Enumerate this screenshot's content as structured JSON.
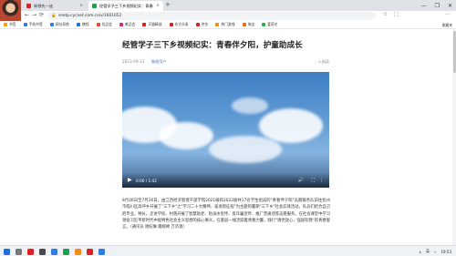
{
  "browser": {
    "tabs": [
      {
        "label": "联想先一迷",
        "favicon_color": "#e02020",
        "active": false
      },
      {
        "label": "经管学子三下乡视频纪实：青春",
        "favicon_color": "#17a34a",
        "active": true
      }
    ],
    "close_glyph": "×",
    "new_tab_glyph": "+",
    "window_controls": [
      "—",
      "❐",
      "✕"
    ],
    "address": "seetp.cycnet.com.cn/v/1601052",
    "lock_glyph": "🔒",
    "nav": {
      "back": "←",
      "forward": "→",
      "reload": "⟳",
      "home": "⌂"
    },
    "right_icons": [
      "☆",
      "⬚",
      "⋯"
    ],
    "bookmarks": [
      {
        "label": "书签",
        "color": "#f2a100"
      },
      {
        "label": "手机书签",
        "color": "#2f7de1"
      },
      {
        "label": "网址导航",
        "color": "#2f7de1"
      },
      {
        "label": "携程",
        "color": "#1f75d6"
      },
      {
        "label": "优品会",
        "color": "#e74c3c"
      },
      {
        "label": "唯品会",
        "color": "#d9257a"
      },
      {
        "label": "天猫精选",
        "color": "#e02020"
      },
      {
        "label": "东方头条",
        "color": "#e02020"
      },
      {
        "label": "京东",
        "color": "#e02020"
      },
      {
        "label": "热门游戏",
        "color": "#f28c18"
      },
      {
        "label": "淘宝",
        "color": "#f26b18"
      },
      {
        "label": "爱奇艺",
        "color": "#2bb24c"
      }
    ],
    "bookmarks_right": "收藏夹"
  },
  "article": {
    "title": "经管学子三下乡视频纪实：青春伴夕阳，护童助成长",
    "date": "2023-09-13",
    "source": "微视用户",
    "reads": "人阅读",
    "video": {
      "play_glyph": "▶",
      "time": "0:00 / 1:42",
      "volume_glyph": "🔊",
      "fullscreen_glyph": "⛶",
      "more_glyph": "⋮"
    },
    "body": "8月26日至7月26日，由江西经济管理干部学院2021级和2022级共17名学生组成的\"青春伴夕阳\"志愿服务队前往抚州市临川区高坪乡开展了\"三下乡\"之\"学习二十大精神，奋进新征程\"为主题的暑期\"三下乡\"社会实践活动。队员们结合自己的专业，特长，走进学校、村落开展了智慧助老、防溺水宣传、反诈骗宣传、推广普通话等志愿服务。在社会课堂中学习领会习近平新时代中国特色社会主义思想的核心要义。在基层一线活跃着青春力量，践行\"请党放心，强国有我\"的青春誓言。（通讯员 谢纪琳 雍婉婷 万济源）"
  },
  "taskbar": {
    "apps": [
      {
        "name": "start",
        "color": "#1e6fd9"
      },
      {
        "name": "search",
        "color": "#777777"
      },
      {
        "name": "app1",
        "color": "#e02020"
      },
      {
        "name": "app2",
        "color": "#4a4a4a"
      },
      {
        "name": "app3",
        "color": "#2f7de1"
      },
      {
        "name": "app4",
        "color": "#17a34a"
      },
      {
        "name": "app5",
        "color": "#f28c18"
      },
      {
        "name": "app6",
        "color": "#e02020"
      },
      {
        "name": "app7",
        "color": "#2f7de1"
      }
    ],
    "tray": [
      "∧",
      "英",
      "⌁"
    ],
    "time": "19:53",
    "date": "2023/9/13"
  }
}
